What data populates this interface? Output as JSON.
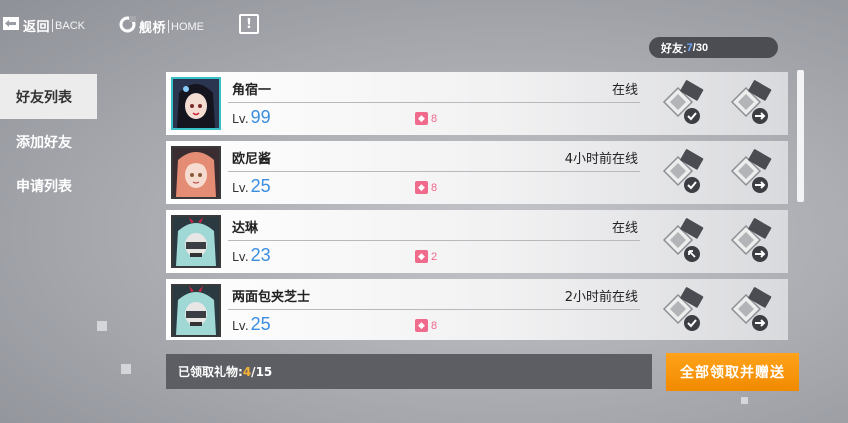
{
  "topbar": {
    "back": {
      "main": "返回",
      "sub": "BACK",
      "icon": "back-arrow-icon"
    },
    "home": {
      "main": "舰桥",
      "sub": "HOME",
      "icon": "home-ring-icon"
    },
    "alert": {
      "label": "!",
      "icon": "alert-icon"
    }
  },
  "friend_count": {
    "label": "好友: ",
    "current": "7",
    "sep": "/",
    "max": "30"
  },
  "sidebar": {
    "tabs": [
      {
        "label": "好友列表",
        "active": true
      },
      {
        "label": "添加好友",
        "active": false
      },
      {
        "label": "申请列表",
        "active": false
      }
    ]
  },
  "friends": [
    {
      "name": "角宿一",
      "status": "在线",
      "lv_prefix": "Lv.",
      "level": "99",
      "gifts": "8"
    },
    {
      "name": "欧尼酱",
      "status": "4小时前在线",
      "lv_prefix": "Lv.",
      "level": "25",
      "gifts": "8"
    },
    {
      "name": "达琳",
      "status": "在线",
      "lv_prefix": "Lv.",
      "level": "23",
      "gifts": "2"
    },
    {
      "name": "两面包夹芝士",
      "status": "2小时前在线",
      "lv_prefix": "Lv.",
      "level": "25",
      "gifts": "8"
    }
  ],
  "gift_bar": {
    "label": "已领取礼物: ",
    "current": "4",
    "sep": "/",
    "max": "15"
  },
  "claim_all_button": {
    "label": "全部领取并赠送"
  },
  "colors": {
    "accent_blue": "#3b8de0",
    "gift_pink": "#f06a8c",
    "claim_orange": "#f18a00",
    "gift_count_yellow": "#f7b336"
  }
}
